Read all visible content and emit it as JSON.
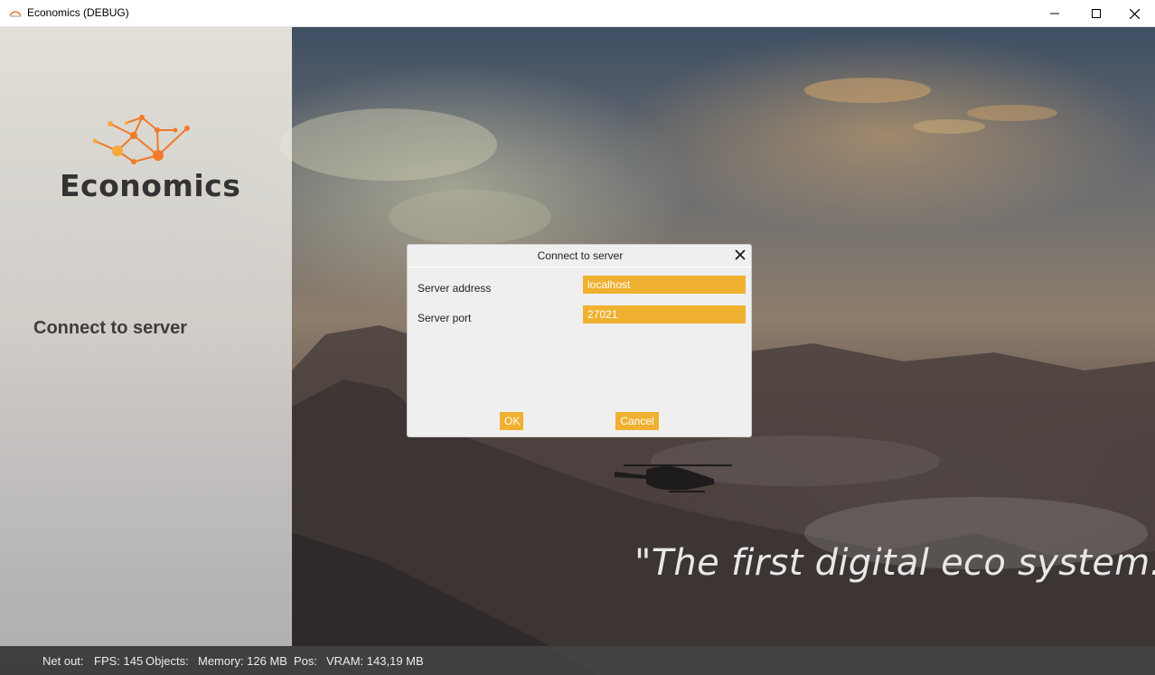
{
  "window": {
    "title": "Economics (DEBUG)",
    "icons": {
      "minimize": "minimize-icon",
      "maximize": "maximize-icon",
      "close": "close-icon"
    }
  },
  "sidebar": {
    "logo_text": "Economics",
    "menu": [
      {
        "label": "Connect to server"
      }
    ]
  },
  "tagline": "\"The first digital eco system.\"",
  "dialog": {
    "title": "Connect to server",
    "fields": [
      {
        "label": "Server address",
        "value": "localhost"
      },
      {
        "label": "Server port",
        "value": "27021"
      }
    ],
    "buttons": {
      "ok": "OK",
      "cancel": "Cancel"
    }
  },
  "statusbar": {
    "net_out": "Net out:",
    "fps": "FPS: 145",
    "objects": "Objects:",
    "memory": "Memory: 126 MB",
    "pos": "Pos:",
    "vram": "VRAM: 143,19 MB"
  },
  "colors": {
    "accent": "#f0b030",
    "logo_orange": "#f07a2a",
    "logo_text": "#333333"
  }
}
